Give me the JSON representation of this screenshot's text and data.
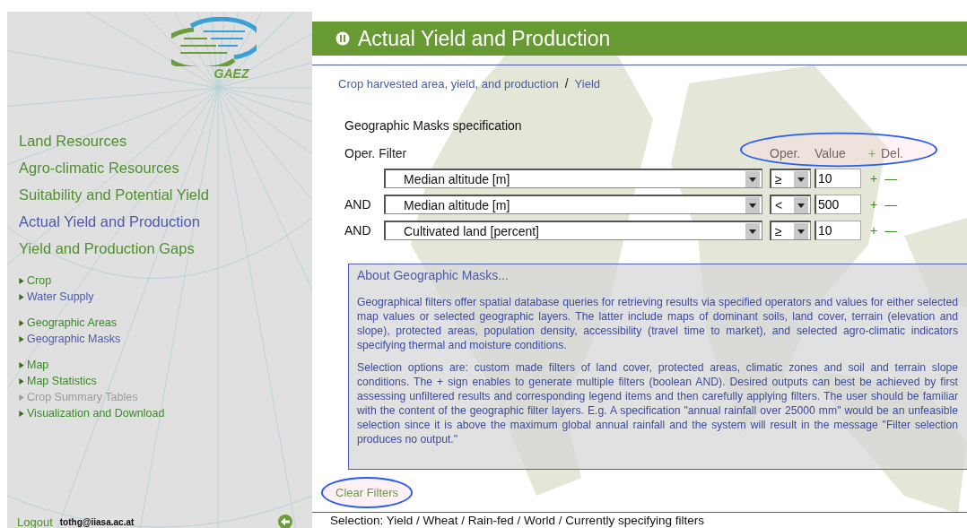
{
  "logo": {
    "text": "GAEZ"
  },
  "nav": {
    "items": [
      {
        "label": "Land Resources",
        "selected": false
      },
      {
        "label": "Agro-climatic Resources",
        "selected": false
      },
      {
        "label": "Suitability and Potential Yield",
        "selected": false
      },
      {
        "label": "Actual Yield and Production",
        "selected": true
      },
      {
        "label": "Yield and Production Gaps",
        "selected": false
      }
    ],
    "groups": [
      [
        {
          "label": "Crop",
          "selected": false,
          "disabled": false
        },
        {
          "label": "Water Supply",
          "selected": true,
          "disabled": false
        }
      ],
      [
        {
          "label": "Geographic Areas",
          "selected": false,
          "disabled": false
        },
        {
          "label": "Geographic Masks",
          "selected": true,
          "disabled": false
        }
      ],
      [
        {
          "label": "Map",
          "selected": false,
          "disabled": false
        },
        {
          "label": "Map Statistics",
          "selected": false,
          "disabled": false
        },
        {
          "label": "Crop Summary Tables",
          "selected": false,
          "disabled": true
        },
        {
          "label": "Visualization and Download",
          "selected": false,
          "disabled": false
        }
      ]
    ]
  },
  "footer": {
    "logout": "Logout",
    "user": "tothg@iiasa.ac.at"
  },
  "page": {
    "title": "Actual Yield and Production",
    "breadcrumb": [
      "Crop harvested area, yield, and production",
      "/",
      "Yield"
    ],
    "section_title": "Geographic Masks specification",
    "columns": {
      "left": "Oper. Filter",
      "oper": "Oper.",
      "value": "Value",
      "add": "+",
      "del": "Del.",
      "circled": true
    },
    "filters": [
      {
        "filter": "Median altitude [m]",
        "operator": "≥",
        "value": "10",
        "add": "+",
        "del": "—"
      },
      {
        "op": "AND",
        "filter": "Median altitude [m]",
        "operator": "<",
        "value": "500",
        "add": "+",
        "del": "—"
      },
      {
        "op": "AND",
        "filter": "Cultivated land [percent]",
        "operator": "≥",
        "value": "10",
        "add": "+",
        "del": "—"
      }
    ],
    "about": {
      "title": "About Geographic Masks...",
      "paragraphs": [
        "Geographical filters offer spatial database queries for retrieving results via specified operators and values for either selected map values or selected geographic layers. The latter include maps of dominant soils, land cover, terrain (elevation and slope), protected areas, population density, accessibility (travel time to market), and selected agro-climatic indicators specifying thermal and moisture conditions.",
        "Selection options are: custom made filters of land cover, protected areas, climatic zones and soil and terrain slope conditions. The + sign enables to generate multiple filters (boolean AND). Desired outputs can best be achieved by first assessing unfiltered results and corresponding legend items and then carefully applying filters. The user should be familiar with the content of the geographic filter layers. E.g. A specification \"annual rainfall over 25000 mm\" would be an unfeasible selection since it is above the maximum global annual rainfall and the system will result in the message \"Filter selection produces no output.\""
      ]
    },
    "clear_filters": {
      "label": "Clear Filters",
      "circled": true
    }
  },
  "status_bar": "Selection: Yield / Wheat / Rain-fed / World / Currently specifying filters"
}
